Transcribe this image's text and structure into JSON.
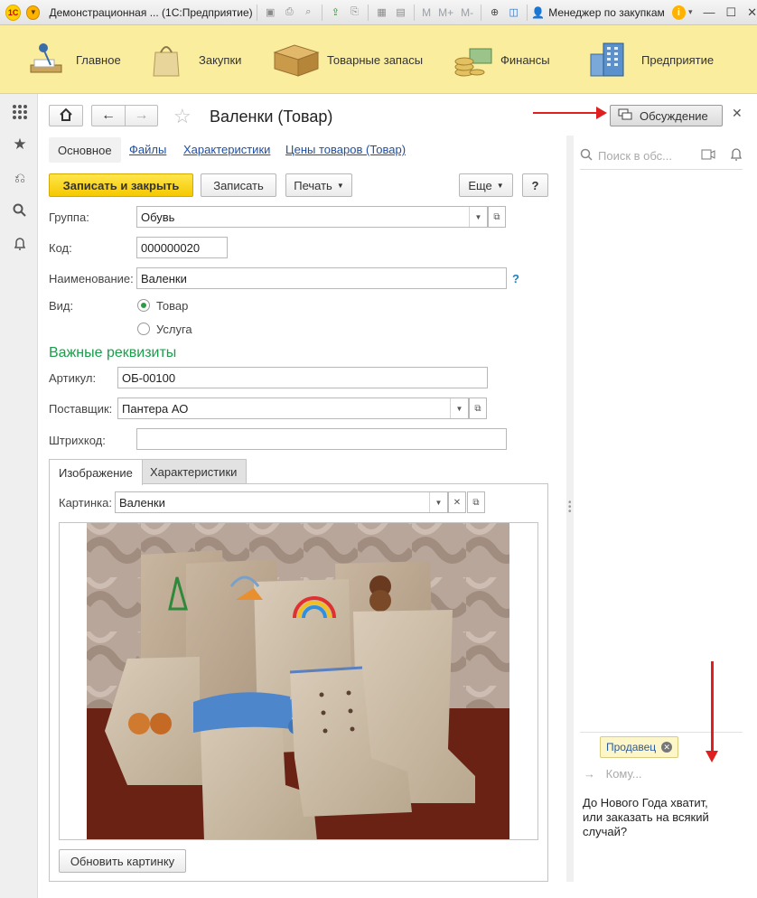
{
  "window": {
    "title": "Демонстрационная ... (1С:Предприятие)",
    "logo": "1С",
    "memory_buttons": [
      "M",
      "M+",
      "M-"
    ],
    "user": "Менеджер по закупкам"
  },
  "sections": [
    {
      "label": "Главное",
      "icon": "desk-lamp-icon"
    },
    {
      "label": "Закупки",
      "icon": "shopping-bag-icon"
    },
    {
      "label": "Товарные запасы",
      "icon": "box-icon"
    },
    {
      "label": "Финансы",
      "icon": "coins-icon"
    },
    {
      "label": "Предприятие",
      "icon": "building-icon"
    }
  ],
  "form": {
    "title": "Валенки (Товар)",
    "discuss_button": "Обсуждение",
    "tabs": {
      "main": "Основное",
      "links": [
        "Файлы",
        "Характеристики",
        "Цены товаров (Товар)"
      ]
    },
    "toolbar": {
      "save_close": "Записать и закрыть",
      "save": "Записать",
      "print": "Печать",
      "more": "Еще",
      "help": "?"
    },
    "fields": {
      "group_label": "Группа:",
      "group_value": "Обувь",
      "code_label": "Код:",
      "code_value": "000000020",
      "name_label": "Наименование:",
      "name_value": "Валенки",
      "name_help": "?",
      "kind_label": "Вид:",
      "kind_options": [
        "Товар",
        "Услуга"
      ],
      "kind_selected": "Товар"
    },
    "important": {
      "title": "Важные реквизиты",
      "article_label": "Артикул:",
      "article_value": "ОБ-00100",
      "supplier_label": "Поставщик:",
      "supplier_value": "Пантера АО",
      "barcode_label": "Штрихкод:",
      "barcode_value": ""
    },
    "inner_tabs": [
      "Изображение",
      "Характеристики"
    ],
    "picture_label": "Картинка:",
    "picture_value": "Валенки",
    "refresh_button": "Обновить картинку"
  },
  "discussion": {
    "search_placeholder": "Поиск в обс...",
    "recipient_chip": "Продавец",
    "to_placeholder": "Кому...",
    "message": "До Нового Года хватит, или заказать на всякий случай?"
  },
  "colors": {
    "sections_bg": "#fbed9e",
    "primary_button": "#f5c800",
    "group_title": "#1a9e4b",
    "link": "#1f4fa0",
    "annotation_arrow": "#e02020"
  }
}
